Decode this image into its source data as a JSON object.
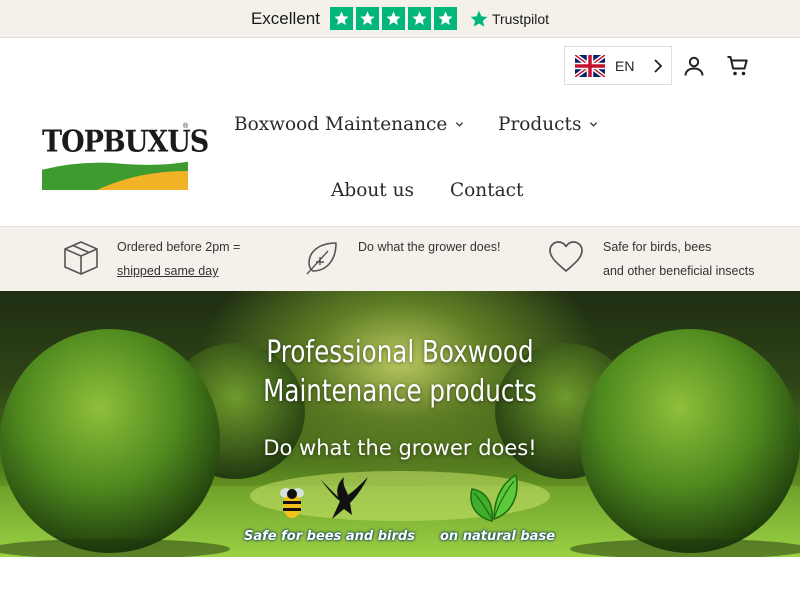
{
  "trustpilot": {
    "rating_word": "Excellent",
    "stars": 5,
    "brand": "Trustpilot",
    "color": "#00b67a"
  },
  "language": {
    "code": "EN",
    "flag": "uk-flag"
  },
  "header_icons": [
    "account-icon",
    "cart-icon"
  ],
  "logo": {
    "text": "TOPBUXUS",
    "registered": "®"
  },
  "nav": {
    "boxwood_maintenance": "Boxwood Maintenance",
    "products": "Products",
    "about": "About us",
    "contact": "Contact"
  },
  "usps": [
    {
      "icon": "box-icon",
      "line1": "Ordered before 2pm =",
      "line2": "shipped same day"
    },
    {
      "icon": "leaf-icon",
      "line1": "Do what the grower does!",
      "line2": ""
    },
    {
      "icon": "heart-icon",
      "line1": "Safe for birds, bees",
      "line2": "and other beneficial insects"
    }
  ],
  "hero": {
    "title_line1": "Professional Boxwood",
    "title_line2": "Maintenance products",
    "subtitle": "Do what the grower does!",
    "badge_safe": "Safe for bees and birds",
    "badge_natural": "on natural base"
  },
  "colors": {
    "usp_bg": "#f3f1ea",
    "logo_green": "#3d9b2f",
    "logo_yellow": "#f2b227"
  }
}
